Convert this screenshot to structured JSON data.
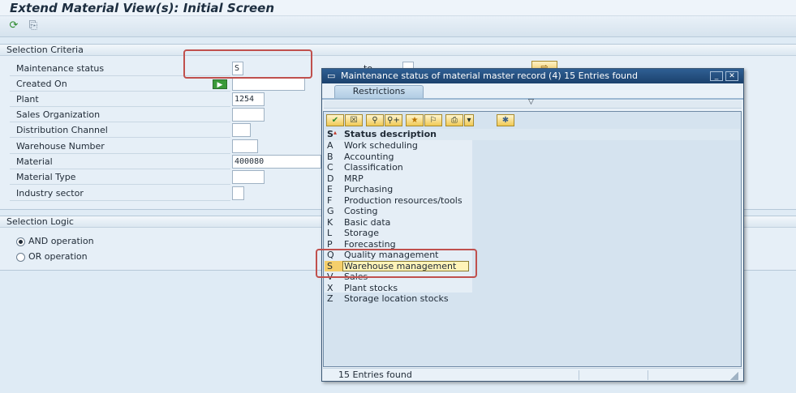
{
  "screen": {
    "title": "Extend Material View(s): Initial Screen",
    "toolbar": {
      "icons": [
        "execute-icon",
        "get-variant-icon"
      ],
      "execute_glyph": "⟳",
      "variant_glyph": "⎘"
    }
  },
  "selection_criteria": {
    "title": "Selection Criteria",
    "fields": [
      {
        "label": "Maintenance status",
        "value": "S"
      },
      {
        "label": "Created On",
        "value": ""
      },
      {
        "label": "Plant",
        "value": "1254"
      },
      {
        "label": "Sales Organization",
        "value": ""
      },
      {
        "label": "Distribution Channel",
        "value": ""
      },
      {
        "label": "Warehouse Number",
        "value": ""
      },
      {
        "label": "Material",
        "value": "400080"
      },
      {
        "label": "Material Type",
        "value": ""
      },
      {
        "label": "Industry sector",
        "value": ""
      }
    ],
    "partial_to_label": "to",
    "multi_select_glyph": "▶",
    "select_options_glyph": "⇨"
  },
  "selection_logic": {
    "title": "Selection Logic",
    "options": [
      {
        "label": "AND operation",
        "checked": true
      },
      {
        "label": "OR operation",
        "checked": false
      }
    ]
  },
  "popup": {
    "title": "Maintenance status of material master record (4)   15 Entries found",
    "title_icon": "▭",
    "minimize_glyph": "_",
    "close_glyph": "✕",
    "tab_label": "Restrictions",
    "collapse_glyph": "▽",
    "toolbar": {
      "buttons": [
        {
          "name": "confirm-icon",
          "glyph": "✔"
        },
        {
          "name": "cancel-icon",
          "glyph": "☒"
        },
        {
          "name": "find-icon",
          "glyph": "⚲"
        },
        {
          "name": "find-next-icon",
          "glyph": "⚲+"
        },
        {
          "name": "favorite-add-icon",
          "glyph": "★"
        },
        {
          "name": "favorite-icon",
          "glyph": "⚐"
        },
        {
          "name": "print-icon",
          "glyph": "⎙"
        },
        {
          "name": "print-dropdown-icon",
          "glyph": "▾"
        },
        {
          "name": "personal-list-icon",
          "glyph": "✱"
        }
      ]
    },
    "columns": {
      "key_header": "S",
      "sort_glyph": "▴",
      "desc_header": "Status description"
    },
    "rows": [
      {
        "key": "A",
        "description": "Work scheduling"
      },
      {
        "key": "B",
        "description": "Accounting"
      },
      {
        "key": "C",
        "description": "Classification"
      },
      {
        "key": "D",
        "description": "MRP"
      },
      {
        "key": "E",
        "description": "Purchasing"
      },
      {
        "key": "F",
        "description": "Production resources/tools"
      },
      {
        "key": "G",
        "description": "Costing"
      },
      {
        "key": "K",
        "description": "Basic data"
      },
      {
        "key": "L",
        "description": "Storage"
      },
      {
        "key": "P",
        "description": "Forecasting"
      },
      {
        "key": "Q",
        "description": "Quality management"
      },
      {
        "key": "S",
        "description": "Warehouse management",
        "selected": true
      },
      {
        "key": "V",
        "description": "Sales"
      },
      {
        "key": "X",
        "description": "Plant stocks"
      },
      {
        "key": "Z",
        "description": "Storage location stocks"
      }
    ],
    "status_text": "15 Entries found"
  },
  "colors": {
    "highlight_border": "#c0504d",
    "popup_title_bg": "#1b416d",
    "selected_row_bg": "#fff3b8"
  }
}
